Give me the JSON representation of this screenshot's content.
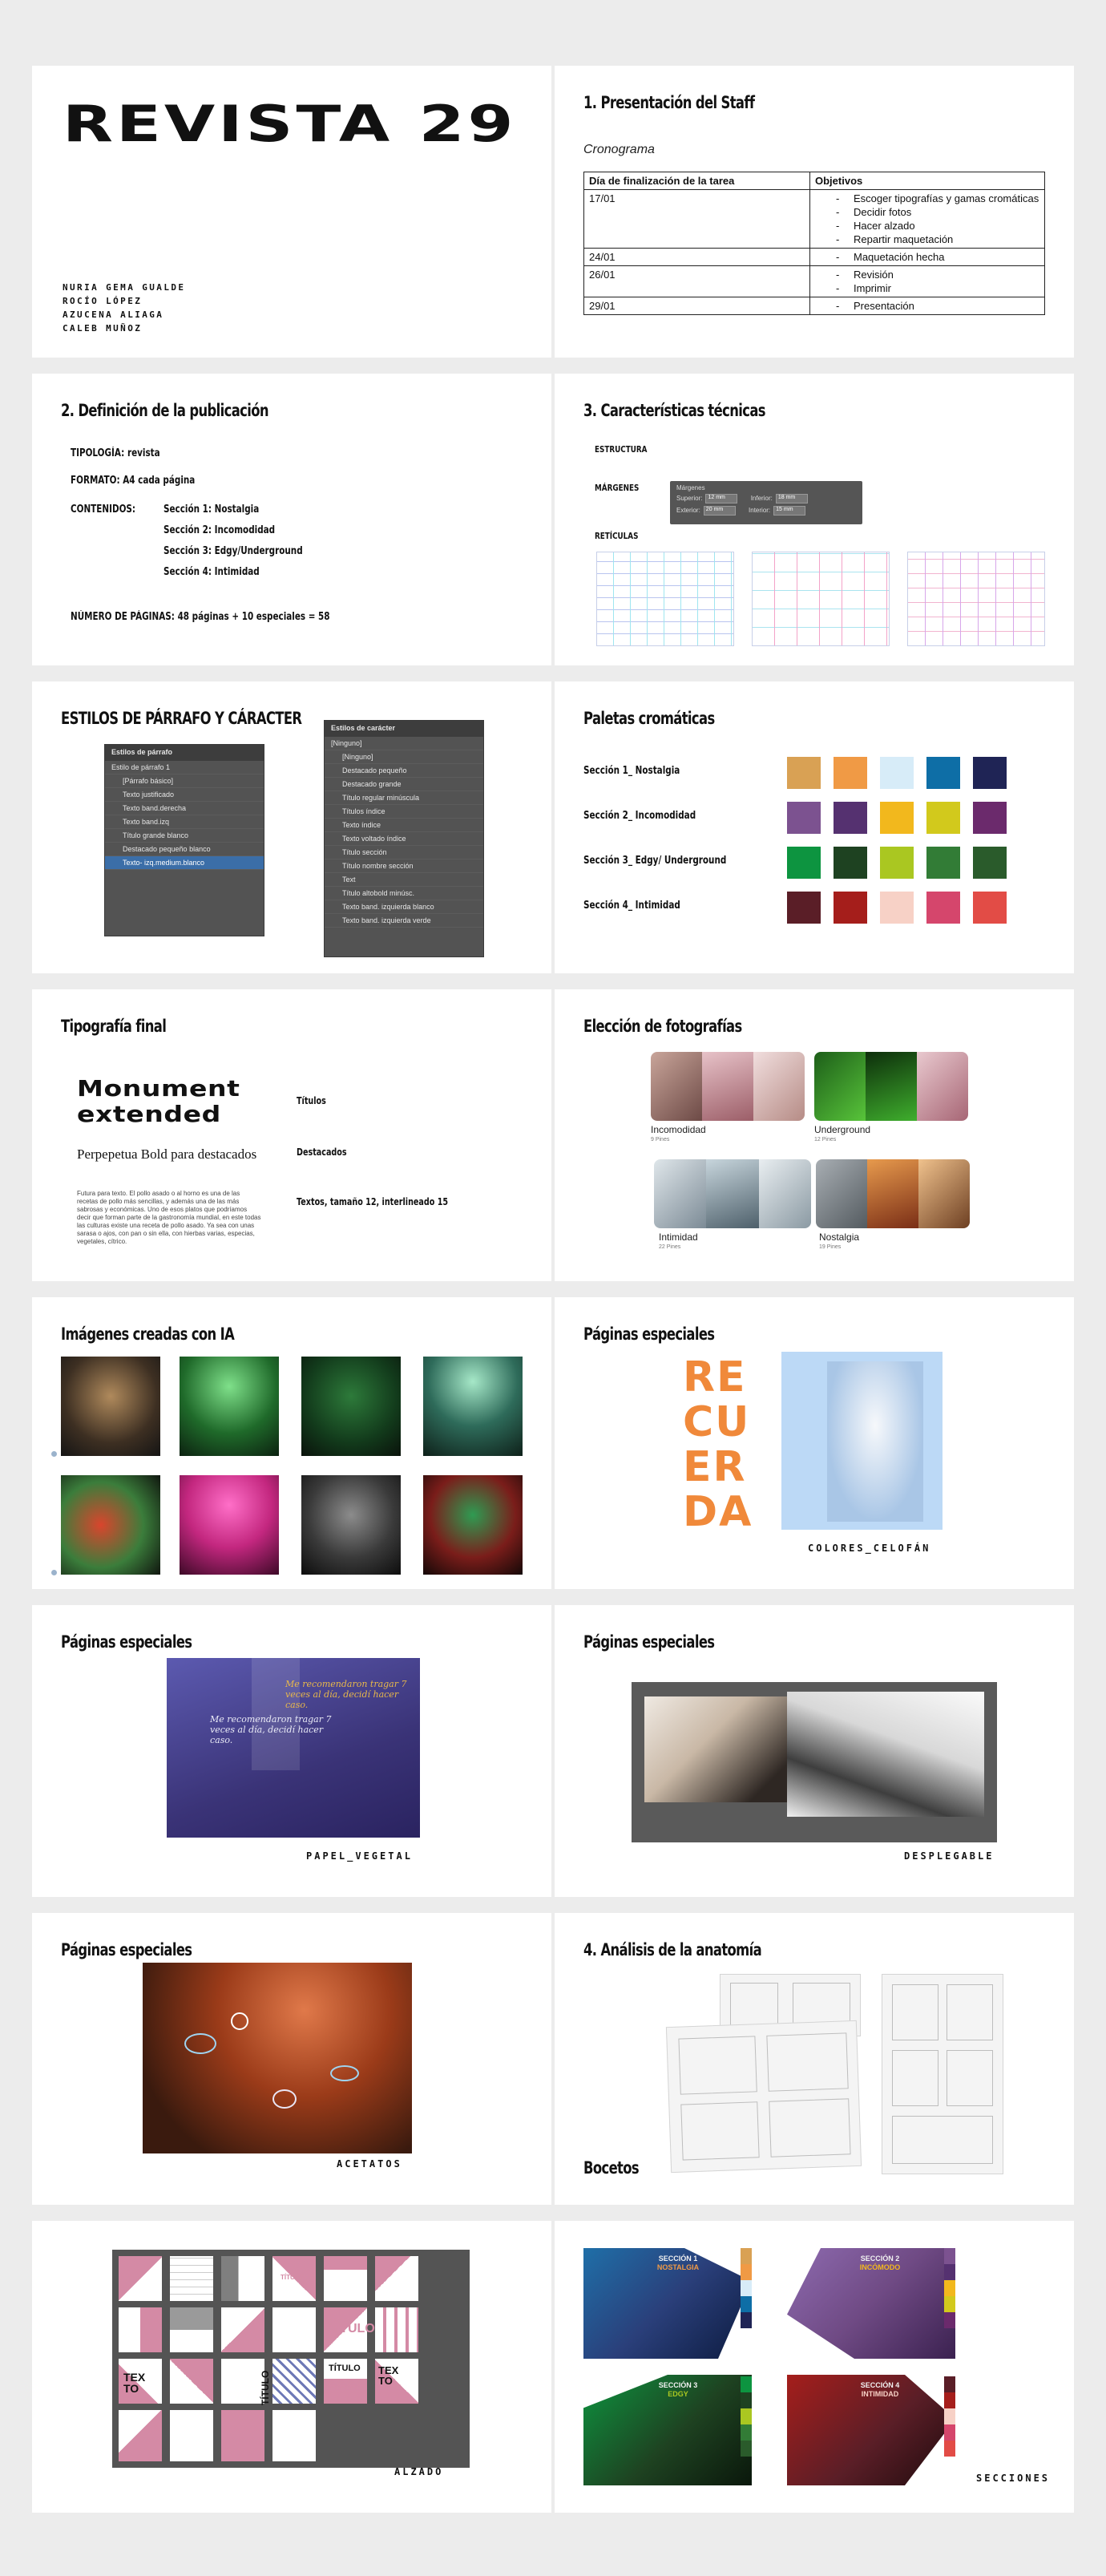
{
  "cover": {
    "title": "REVISTA 29",
    "staff": [
      "NURIA GEMA GUALDE",
      "ROCÍO LÓPEZ",
      "AZUCENA ALIAGA",
      "CALEB MUÑOZ"
    ]
  },
  "staff_slide": {
    "title": "1. Presentación del Staff",
    "subtitle": "Cronograma",
    "table": {
      "headers": [
        "Día de finalización de la tarea",
        "Objetivos"
      ],
      "rows": [
        {
          "date": "17/01",
          "items": [
            "Escoger tipografías y gamas cromáticas",
            "Decidir fotos",
            "Hacer alzado",
            "Repartir maquetación"
          ]
        },
        {
          "date": "24/01",
          "items": [
            "Maquetación hecha"
          ]
        },
        {
          "date": "26/01",
          "items": [
            "Revisión",
            "Imprimir"
          ]
        },
        {
          "date": "29/01",
          "items": [
            "Presentación"
          ]
        }
      ]
    }
  },
  "definition": {
    "title": "2. Definición de la publicación",
    "tipologia": "TIPOLOGÍA: revista",
    "formato": "FORMATO:  A4 cada página",
    "contenidos_label": "CONTENIDOS:",
    "secciones": [
      "Sección 1: Nostalgia",
      "Sección 2: Incomodidad",
      "Sección 3: Edgy/Underground",
      "Sección 4: Intimidad"
    ],
    "paginas": "NÚMERO DE PÁGINAS: 48 páginas + 10 especiales = 58"
  },
  "tech": {
    "title": "3. Características técnicas",
    "estructura": "ESTRUCTURA",
    "margenes": "MÁRGENES",
    "reticulas": "RETÍCULAS",
    "margins_panel": {
      "heading": "Márgenes",
      "superior_label": "Superior:",
      "superior": "12 mm",
      "inferior_label": "Inferior:",
      "inferior": "18 mm",
      "exterior_label": "Exterior:",
      "exterior": "20 mm",
      "interior_label": "Interior:",
      "interior": "15 mm"
    }
  },
  "styles": {
    "title": "ESTILOS DE PÁRRAFO Y CÁRACTER",
    "paragraph_panel": {
      "title": "Estilos de párrafo",
      "current": "Estilo de párrafo 1",
      "items": [
        "[Párrafo básico]",
        "Texto justificado",
        "Texto band.derecha",
        "Texto band.izq",
        "Título grande blanco",
        "Destacado pequeño blanco",
        "Texto- izq.medium.blanco"
      ],
      "selected_index": 6
    },
    "character_panel": {
      "title": "Estilos de carácter",
      "items": [
        "[Ninguno]",
        "[Ninguno]",
        "Destacado pequeño",
        "Destacado grande",
        "Título regular minúscula",
        "Títulos índice",
        "Texto índice",
        "Texto voltado índice",
        "Título sección",
        "Título nombre sección",
        "Text",
        "Título altobold minúsc.",
        "Texto band. izquierda blanco",
        "Texto band. izquierda verde"
      ]
    }
  },
  "palettes": {
    "title": "Paletas cromáticas",
    "rows": [
      {
        "label": "Sección 1_ Nostalgia",
        "colors": [
          "#d9a154",
          "#f09a45",
          "#d7ecf8",
          "#0e6ea6",
          "#1f2455"
        ]
      },
      {
        "label": "Sección 2_ Incomodidad",
        "colors": [
          "#7c5290",
          "#553170",
          "#f2b81d",
          "#d2c91c",
          "#6b2a6c"
        ]
      },
      {
        "label": "Sección 3_ Edgy/ Underground",
        "colors": [
          "#0d9440",
          "#1e4221",
          "#aac721",
          "#327c36",
          "#2a5b2b"
        ]
      },
      {
        "label": "Sección 4_ Intimidad",
        "colors": [
          "#5a1e27",
          "#a51e1b",
          "#f7d1c6",
          "#d5466c",
          "#e24c46"
        ]
      }
    ]
  },
  "typography": {
    "title": "Tipografía final",
    "monument": "Monument extended",
    "perpetua": "Perpepetua Bold para destacados",
    "paragraph": "Futura para texto. El pollo asado o al horno es una de las recetas de pollo más sencillas, y además una de las más sabrosas y económicas. Uno de esos platos que podríamos decir que forman parte de la gastronomía mundial, en este todas las culturas existe una receta de pollo asado. Ya sea con unas sarasa o ajos, con pan o sin ella, con hierbas varias, especias, vegetales, cítrico.",
    "label_titulos": "Títulos",
    "label_destacados": "Destacados",
    "label_textos": "Textos, tamaño 12, interlineado 15"
  },
  "photos": {
    "title": "Elección de fotografías",
    "boards": [
      {
        "name": "Incomodidad",
        "pins": "9 Pines"
      },
      {
        "name": "Underground",
        "pins": "12 Pines"
      },
      {
        "name": "Intimidad",
        "pins": "22 Pines"
      },
      {
        "name": "Nostalgia",
        "pins": "19 Pines"
      }
    ]
  },
  "ai": {
    "title": "Imágenes creadas con IA"
  },
  "special1": {
    "title": "Páginas especiales",
    "recuerda": [
      "RE",
      "CU",
      "ER",
      "DA"
    ],
    "caption": "COLORES_CELOFÁN"
  },
  "special2": {
    "title": "Páginas especiales",
    "quote_a": "Me recomendaron tragar 7 veces al día, decidí hacer caso.",
    "quote_b": "Me recomendaron tragar 7 veces al día, decidí hacer caso.",
    "caption": "PAPEL_VEGETAL"
  },
  "special3": {
    "title": "Páginas especiales",
    "caption": "DESPLEGABLE"
  },
  "special4": {
    "title": "Páginas especiales",
    "caption": "ACETATOS"
  },
  "anatomy": {
    "title": "4. Análisis de la anatomía",
    "bocetos": "Bocetos"
  },
  "alzado": {
    "caption": "ALZADO",
    "words": [
      "TEX TO",
      "TÍTULO",
      "TÍTULO",
      "TÍTULO",
      "TEX TO",
      "TÍTULO"
    ]
  },
  "secciones": {
    "caption": "SECCIONES",
    "cards": [
      {
        "line1": "SECCIÓN 1",
        "line2": "NOSTALGIA"
      },
      {
        "line1": "SECCIÓN 2",
        "line2": "INCÓMODO"
      },
      {
        "line1": "SECCIÓN 3",
        "line2": "EDGY"
      },
      {
        "line1": "SECCIÓN 4",
        "line2": "INTIMIDAD"
      }
    ]
  }
}
